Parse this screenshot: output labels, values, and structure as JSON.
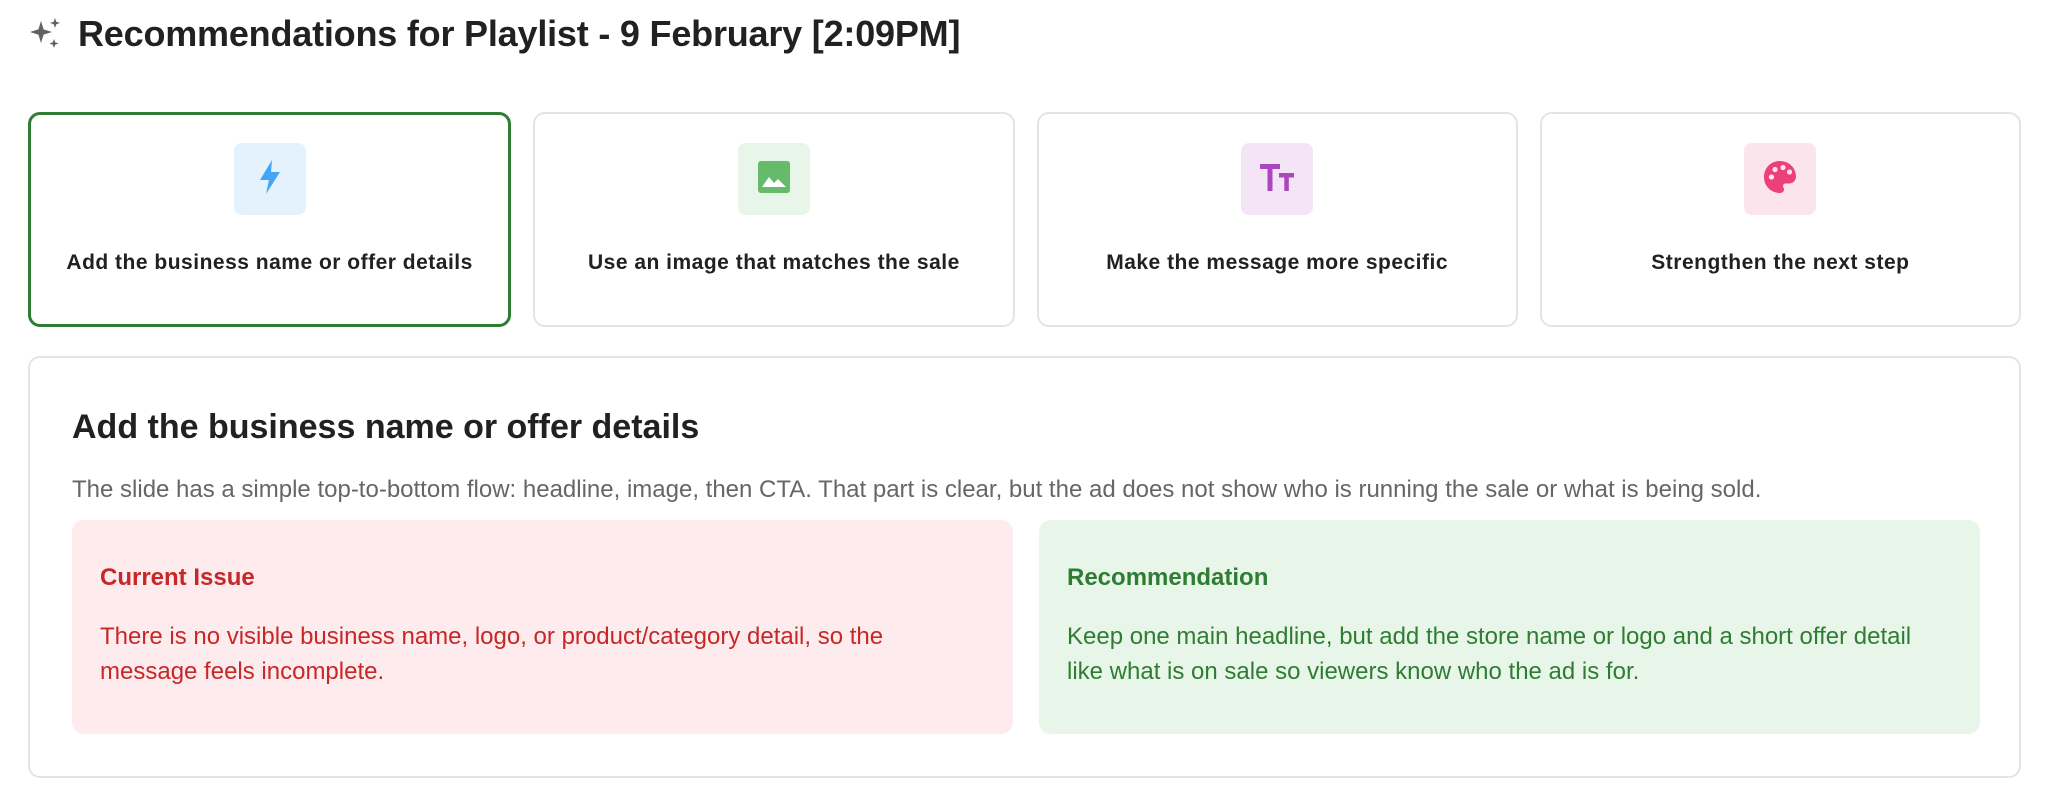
{
  "header": {
    "icon": "sparkle-icon",
    "title": "Recommendations for Playlist - 9 February [2:09PM]"
  },
  "cards": [
    {
      "label": "Add the business name or offer details",
      "icon": "lightning-bolt-icon",
      "icon_color": "#42a5f5",
      "icon_bg": "#e3f2fd",
      "selected": true
    },
    {
      "label": "Use an image that matches the sale",
      "icon": "image-icon",
      "icon_color": "#66bb6a",
      "icon_bg": "#e8f5e9",
      "selected": false
    },
    {
      "label": "Make the message more specific",
      "icon": "text-size-icon",
      "icon_color": "#ab47bc",
      "icon_bg": "#f3e5f5",
      "selected": false
    },
    {
      "label": "Strengthen the next step",
      "icon": "palette-icon",
      "icon_color": "#ec407a",
      "icon_bg": "#fce4ec",
      "selected": false
    }
  ],
  "detail": {
    "title": "Add the business name or offer details",
    "description": "The slide has a simple top-to-bottom flow: headline, image, then CTA. That part is clear, but the ad does not show who is running the sale or what is being sold.",
    "issue": {
      "title": "Current Issue",
      "text": "There is no visible business name, logo, or product/category detail, so the message feels incomplete."
    },
    "recommendation": {
      "title": "Recommendation",
      "text": "Keep one main headline, but add the store name or logo and a short offer detail like what is on sale so viewers know who the ad is for."
    }
  },
  "colors": {
    "selected_border": "#2e7d32",
    "issue_text": "#c62828",
    "issue_bg": "#fdebed",
    "recommendation_text": "#2e7d32",
    "recommendation_bg": "#e8f5e9"
  }
}
